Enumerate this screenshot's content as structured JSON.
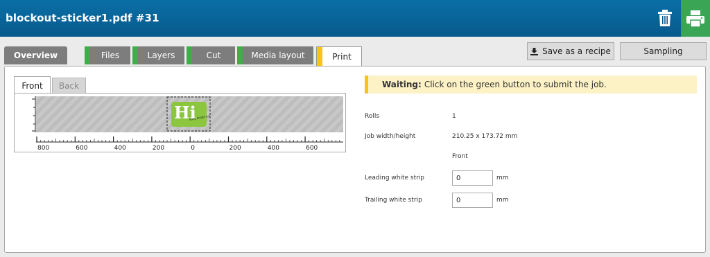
{
  "header": {
    "title": "blockout-sticker1.pdf #31"
  },
  "tabs": [
    {
      "label": "Overview"
    },
    {
      "label": "Files"
    },
    {
      "label": "Layers"
    },
    {
      "label": "Cut"
    },
    {
      "label": "Media layout"
    },
    {
      "label": "Print"
    }
  ],
  "toolbar": {
    "save_recipe_label": "Save as a recipe",
    "sampling_label": "Sampling"
  },
  "preview": {
    "front_tab": "Front",
    "back_tab": "Back",
    "ruler_labels": [
      "800",
      "600",
      "400",
      "200",
      "0",
      "200",
      "400",
      "600"
    ],
    "sticker_text": "Hi",
    "sticker_small_text": "hang bright on!"
  },
  "status": {
    "prefix": "Waiting:",
    "message": "Click on the green button to submit the job."
  },
  "details": {
    "rolls_label": "Rolls",
    "rolls_value": "1",
    "job_size_label": "Job width/height",
    "job_size_value": "210.25 x 173.72 mm",
    "side_value": "Front",
    "leading_label": "Leading white strip",
    "leading_value": "0",
    "trailing_label": "Trailing white strip",
    "trailing_value": "0",
    "unit": "mm"
  },
  "colors": {
    "header": "#075a8c",
    "accent_green": "#3aa655",
    "accent_yellow": "#f5c518"
  }
}
